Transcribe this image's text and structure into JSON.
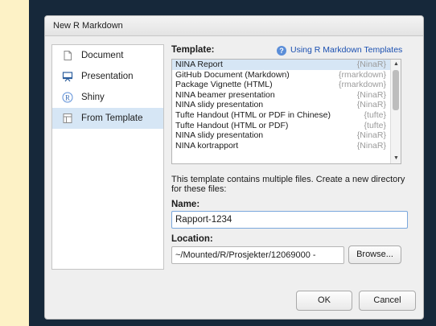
{
  "dialog": {
    "title": "New R Markdown"
  },
  "sidebar": {
    "items": [
      {
        "label": "Document",
        "icon": "document-icon"
      },
      {
        "label": "Presentation",
        "icon": "presentation-icon"
      },
      {
        "label": "Shiny",
        "icon": "shiny-icon"
      },
      {
        "label": "From Template",
        "icon": "template-icon",
        "selected": true
      }
    ]
  },
  "template_section": {
    "label": "Template:",
    "help_text": "Using R Markdown Templates",
    "items": [
      {
        "name": "NINA Report",
        "package": "{NinaR}",
        "selected": true
      },
      {
        "name": "GitHub Document (Markdown)",
        "package": "{rmarkdown}"
      },
      {
        "name": "Package Vignette (HTML)",
        "package": "{rmarkdown}"
      },
      {
        "name": "NINA beamer presentation",
        "package": "{NinaR}"
      },
      {
        "name": "NINA slidy presentation",
        "package": "{NinaR}"
      },
      {
        "name": "Tufte Handout (HTML or PDF in Chinese)",
        "package": "{tufte}"
      },
      {
        "name": "Tufte Handout (HTML or PDF)",
        "package": "{tufte}"
      },
      {
        "name": "NINA slidy presentation",
        "package": "{NinaR}"
      },
      {
        "name": "NINA kortrapport",
        "package": "{NinaR}"
      }
    ]
  },
  "description": "This template contains multiple files. Create a new directory for these files:",
  "name_field": {
    "label": "Name:",
    "value": "Rapport-1234"
  },
  "location_field": {
    "label": "Location:",
    "value": "~/Mounted/R/Prosjekter/12069000 -",
    "browse_label": "Browse..."
  },
  "footer": {
    "ok_label": "OK",
    "cancel_label": "Cancel"
  },
  "colors": {
    "selection": "#d6e6f5",
    "link": "#1a4fb0",
    "background_outer": "#fdf2c6",
    "background_window": "#16283a"
  }
}
